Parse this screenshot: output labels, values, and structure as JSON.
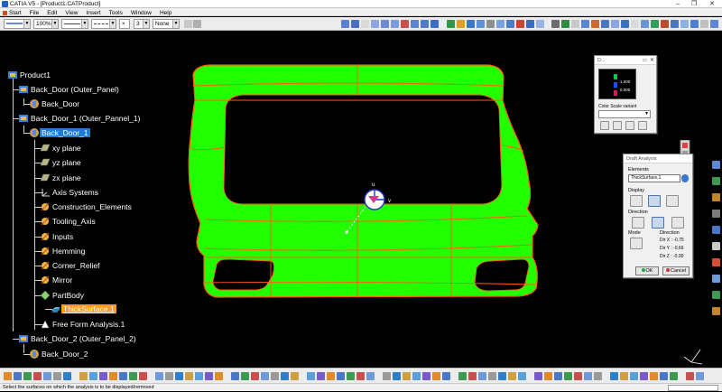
{
  "window": {
    "title": "CATIA V5 - [Product1.CATProduct]",
    "controls": [
      "–",
      "❐",
      "✕"
    ]
  },
  "menu": {
    "items": [
      "Start",
      "File",
      "Edit",
      "View",
      "Insert",
      "Tools",
      "Window",
      "Help"
    ]
  },
  "toolbar": {
    "zoom": "100%",
    "layer_number": "3",
    "layer_name": "None"
  },
  "tree": {
    "nodes": [
      {
        "id": "product1",
        "label": "Product1",
        "icon": "product-icon"
      },
      {
        "id": "back-door-outer-panel",
        "label": "Back_Door (Outer_Panel)",
        "icon": "product-icon"
      },
      {
        "id": "back-door",
        "label": "Back_Door",
        "icon": "part-icon"
      },
      {
        "id": "back-door-1-outer-pannel-1",
        "label": "Back_Door_1 (Outer_Pannel_1)",
        "icon": "product-icon"
      },
      {
        "id": "back-door-1",
        "label": "Back_Door_1",
        "icon": "part-icon"
      },
      {
        "id": "xy-plane",
        "label": "xy plane",
        "icon": "plane-icon"
      },
      {
        "id": "yz-plane",
        "label": "yz plane",
        "icon": "plane-icon"
      },
      {
        "id": "zx-plane",
        "label": "zx plane",
        "icon": "plane-icon"
      },
      {
        "id": "axis-systems",
        "label": "Axis Systems",
        "icon": "axis-icon"
      },
      {
        "id": "construction-elements",
        "label": "Construction_Elements",
        "icon": "geoset-icon"
      },
      {
        "id": "tooling-axis",
        "label": "Tooling_Axis",
        "icon": "geoset-icon"
      },
      {
        "id": "inputs",
        "label": "Inputs",
        "icon": "geoset-icon"
      },
      {
        "id": "hemming",
        "label": "Hemming",
        "icon": "geoset-icon"
      },
      {
        "id": "corner-relief",
        "label": "Corner_Relief",
        "icon": "geoset-icon"
      },
      {
        "id": "mirror",
        "label": "Mirror",
        "icon": "geoset-icon"
      },
      {
        "id": "partbody",
        "label": "PartBody",
        "icon": "body-icon"
      },
      {
        "id": "thicksurface-1",
        "label": "ThickSurface.1",
        "icon": "thick-surface-icon"
      },
      {
        "id": "free-form-analysis-1",
        "label": "Free Form Analysis.1",
        "icon": "analysis-icon"
      },
      {
        "id": "back-door-2-outer-panel-2",
        "label": "Back_Door_2 (Outer_Panel_2)",
        "icon": "product-icon"
      },
      {
        "id": "back-door-2",
        "label": "Back_Door_2",
        "icon": "part-icon"
      }
    ]
  },
  "viewport": {
    "surface_color": "#22ff00",
    "edge_color": "#ff5a1a",
    "axis_labels": {
      "u": "u",
      "v": "v"
    }
  },
  "color_scale": {
    "title": "D...",
    "variant_label": "Color Scale variant",
    "colors": [
      "#00c853",
      "#1a4dff",
      "#d81b60"
    ],
    "values": [
      "",
      "1.000",
      "0.000"
    ]
  },
  "draft_analysis": {
    "title": "Draft Analysis",
    "elements_label": "Elements",
    "elements_value": "ThickSurface.1",
    "display_label": "Display",
    "direction_label": "Direction",
    "mode_label": "Mode",
    "direction_group_label": "Direction",
    "dir_x": "Dir X : -0.75",
    "dir_y": "Dir Y : -0.66",
    "dir_z": "Dir Z : -0.00",
    "ok_label": "OK",
    "cancel_label": "Cancel"
  },
  "status": {
    "message": "Select the surfaces on which the analysis is to be displayed/removed"
  }
}
